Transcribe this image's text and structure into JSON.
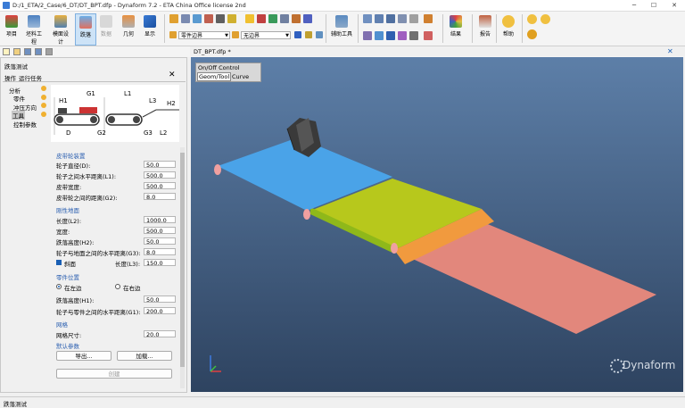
{
  "window": {
    "title": "D:/1_ETA/2_Case/6_DT/DT_BPT.dfp - Dynaform 7.2  - ETA China Office license 2nd",
    "minimize": "─",
    "maximize": "☐",
    "close": "✕"
  },
  "ribbon": {
    "btn_project": "项目",
    "btn_blank": "坯料工程",
    "btn_die": "模面设计",
    "btn_dt": "跌落",
    "btn_data": "数据",
    "btn_geom": "几何",
    "btn_display": "显示",
    "combo_part": "零件边界",
    "combo_boundary": "无边界",
    "btn_aux": "辅助工具",
    "btn_result": "结果",
    "btn_report": "报告",
    "btn_help": "帮助"
  },
  "panel": {
    "title": "跌落测试",
    "tab_op": "操作",
    "tab_run": "运行任务",
    "tree": [
      "分析",
      "零件",
      "冲压方向",
      "工具",
      "控制参数"
    ],
    "diagram": {
      "h1": "H1",
      "g1": "G1",
      "l1": "L1",
      "l3": "L3",
      "h2": "H2",
      "d": "D",
      "g2": "G2",
      "g3": "G3",
      "l2": "L2"
    },
    "sec_belt": "皮带轮装置",
    "belt": [
      {
        "label": "轮子直径(D):",
        "value": "50.0"
      },
      {
        "label": "轮子之间水平距离(L1):",
        "value": "500.0"
      },
      {
        "label": "皮带宽度:",
        "value": "500.0"
      },
      {
        "label": "皮带轮之间的距离(G2):",
        "value": "8.0"
      }
    ],
    "sec_ground": "刚性地面",
    "ground": [
      {
        "label": "长度(L2):",
        "value": "1000.0"
      },
      {
        "label": "宽度:",
        "value": "500.0"
      },
      {
        "label": "跌落高度(H2):",
        "value": "50.0"
      },
      {
        "label": "轮子与地面之间的水平距离(G3):",
        "value": "8.0"
      }
    ],
    "slope_label": "斜面",
    "slope_len_label": "长度(L3):",
    "slope_len_value": "150.0",
    "sec_part_pos": "零件位置",
    "radio_left": "在左边",
    "radio_right": "在右边",
    "part_pos": [
      {
        "label": "跌落高度(H1):",
        "value": "50.0"
      },
      {
        "label": "轮子与零件之间的水平距离(G1):",
        "value": "200.0"
      }
    ],
    "sec_mesh": "网格",
    "mesh_label": "网格尺寸:",
    "mesh_value": "20.0",
    "sec_default": "默认参数",
    "btn_export": "导出...",
    "btn_load": "加载...",
    "btn_create": "创建",
    "close": "✕"
  },
  "viewport": {
    "tab": "DT_BPT.dfp *",
    "overlay_title": "On/Off Control",
    "overlay_tab1": "Geom/Tool",
    "overlay_tab2": "Curve",
    "logo": "Dynaform",
    "bg_top": "#5d7fa8",
    "bg_bottom": "#2e4360",
    "color_belt1": "#4aa3e8",
    "color_belt2": "#b7c81c",
    "color_slope": "#f19a3e",
    "color_ground": "#e2877c"
  },
  "statusbar": {
    "text": "跌落测试"
  }
}
